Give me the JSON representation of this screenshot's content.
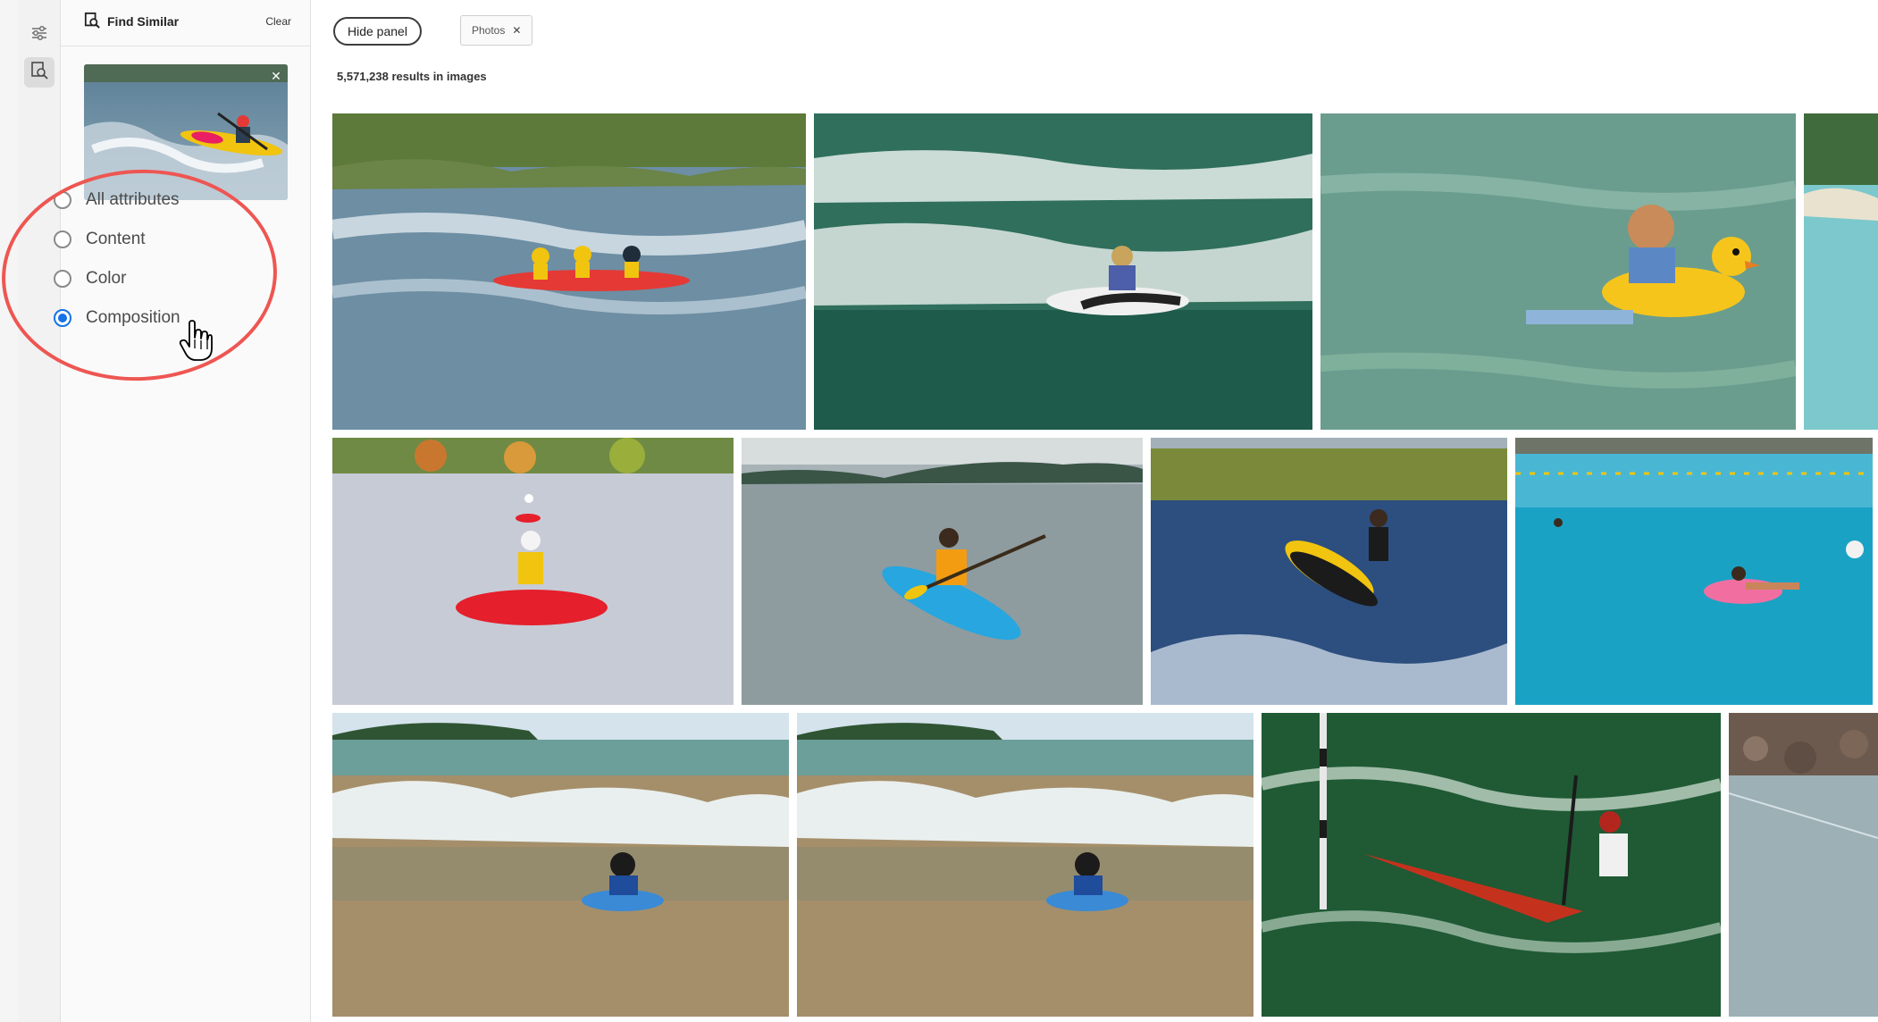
{
  "panel": {
    "title": "Find Similar",
    "clear_label": "Clear",
    "options": [
      {
        "label": "All attributes",
        "checked": false
      },
      {
        "label": "Content",
        "checked": false
      },
      {
        "label": "Color",
        "checked": false
      },
      {
        "label": "Composition",
        "checked": true
      }
    ]
  },
  "toolbar": {
    "hide_panel_label": "Hide panel",
    "filter_tag": "Photos",
    "filter_tag_close": "✕"
  },
  "results": {
    "count_text": "5,571,238 results in images"
  },
  "icons": {
    "rail_filters": "sliders-icon",
    "rail_find_similar": "image-search-icon",
    "thumb_close": "close-icon",
    "cursor": "hand-pointer-icon"
  },
  "colors": {
    "accent": "#1473e6",
    "annotation": "#ee5652"
  },
  "images": [
    {
      "subject": "rafting-kayakers-river"
    },
    {
      "subject": "surfer-in-waves"
    },
    {
      "subject": "child-with-duck-float"
    },
    {
      "subject": "beach-partial"
    },
    {
      "subject": "red-kayak-lake"
    },
    {
      "subject": "blue-kayak-paddler"
    },
    {
      "subject": "jet-ski-rider"
    },
    {
      "subject": "pool-float-swimmers"
    },
    {
      "subject": "boy-bodyboard-beach-1"
    },
    {
      "subject": "boy-bodyboard-beach-2"
    },
    {
      "subject": "slalom-canoe-paddler"
    },
    {
      "subject": "rocky-shore-partial"
    }
  ]
}
